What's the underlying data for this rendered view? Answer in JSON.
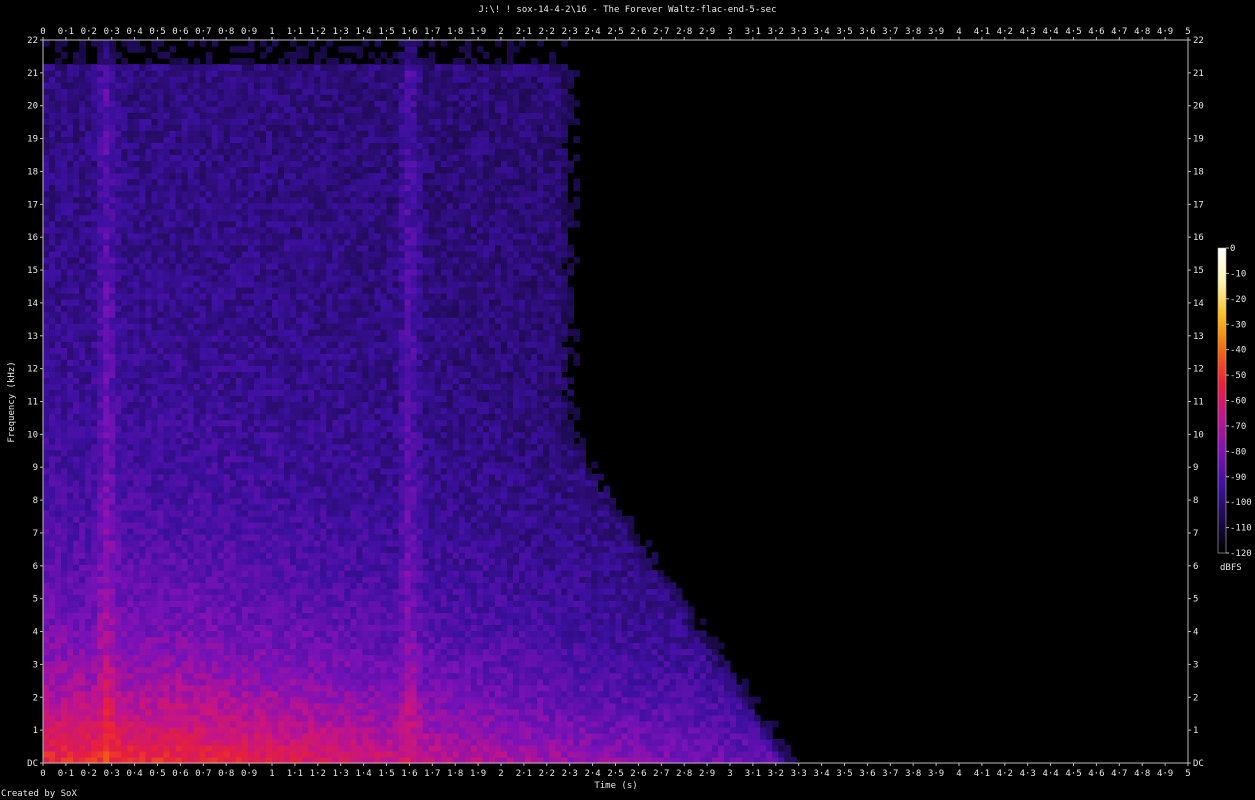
{
  "chart_data": {
    "type": "heatmap",
    "title": "J:\\! ! sox-14-4-2\\16 - The Forever Waltz-flac-end-5-sec",
    "xlabel": "Time (s)",
    "ylabel": "Frequency (kHz)",
    "xlim": [
      0,
      5
    ],
    "ylim": [
      0,
      22
    ],
    "x_ticks": [
      "0",
      "0·1",
      "0·2",
      "0·3",
      "0·4",
      "0·5",
      "0·6",
      "0·7",
      "0·8",
      "0·9",
      "1",
      "1·1",
      "1·2",
      "1·3",
      "1·4",
      "1·5",
      "1·6",
      "1·7",
      "1·8",
      "1·9",
      "2",
      "2·1",
      "2·2",
      "2·3",
      "2·4",
      "2·5",
      "2·6",
      "2·7",
      "2·8",
      "2·9",
      "3",
      "3·1",
      "3·2",
      "3·3",
      "3·4",
      "3·5",
      "3·6",
      "3·7",
      "3·8",
      "3·9",
      "4",
      "4·1",
      "4·2",
      "4·3",
      "4·4",
      "4·5",
      "4·6",
      "4·7",
      "4·8",
      "4·9",
      "5"
    ],
    "y_ticks": [
      "DC",
      "1",
      "2",
      "3",
      "4",
      "5",
      "6",
      "7",
      "8",
      "9",
      "10",
      "11",
      "12",
      "13",
      "14",
      "15",
      "16",
      "17",
      "18",
      "19",
      "20",
      "21",
      "22"
    ],
    "colorbar": {
      "unit": "dBFS",
      "range": [
        -120,
        0
      ],
      "ticks": [
        "0",
        "-10",
        "-20",
        "-30",
        "-40",
        "-50",
        "-60",
        "-70",
        "-80",
        "-90",
        "-100",
        "-110",
        "-120"
      ],
      "colors": [
        "#000000",
        "#1b0a4a",
        "#3c10a0",
        "#7a12b8",
        "#c0148c",
        "#e8203a",
        "#f46a0a",
        "#fbbd1c",
        "#fff5b0",
        "#ffffff"
      ]
    },
    "signal_end_s": 3.3,
    "transients_s": [
      0.28,
      1.6
    ]
  },
  "footer": {
    "credit": "Created by SoX"
  }
}
